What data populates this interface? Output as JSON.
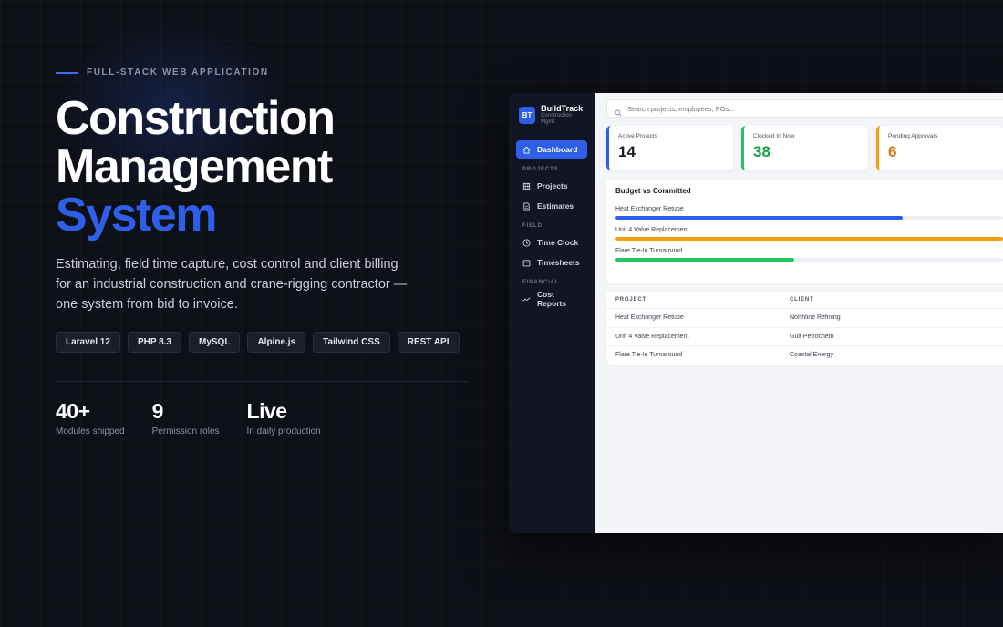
{
  "hero": {
    "eyebrow": "FULL-STACK WEB APPLICATION",
    "title_line1": "Construction",
    "title_line2": "Management",
    "title_line3": "System",
    "description": "Estimating, field time capture, cost control and client billing for an industrial construction and crane-rigging contractor — one system from bid to invoice.",
    "tags": [
      "Laravel 12",
      "PHP 8.3",
      "MySQL",
      "Alpine.js",
      "Tailwind CSS",
      "REST API"
    ],
    "stats": [
      {
        "value": "40+",
        "label": "Modules shipped"
      },
      {
        "value": "9",
        "label": "Permission roles"
      },
      {
        "value": "Live",
        "label": "In daily production"
      }
    ]
  },
  "app": {
    "brand": {
      "logo": "BT",
      "name": "BuildTrack",
      "subtitle": "Construction Mgmt"
    },
    "nav": {
      "dashboard": "Dashboard",
      "section_projects": "PROJECTS",
      "projects": "Projects",
      "estimates": "Estimates",
      "section_field": "FIELD",
      "time_clock": "Time Clock",
      "timesheets": "Timesheets",
      "section_financial": "FINANCIAL",
      "cost_reports": "Cost Reports"
    },
    "search": {
      "placeholder": "Search projects, employees, POs..."
    },
    "kpis": [
      {
        "label": "Active Projects",
        "value": "14",
        "color": "#2f5fe8",
        "value_color": "#161a24"
      },
      {
        "label": "Clocked In Now",
        "value": "38",
        "color": "#22c55e",
        "value_color": "#16a34a"
      },
      {
        "label": "Pending Approvals",
        "value": "6",
        "color": "#f59e0b",
        "value_color": "#d97706"
      }
    ],
    "budget": {
      "title": "Budget vs Committed",
      "rows": [
        {
          "label": "Heat Exchanger Retube",
          "fraction": 0.74,
          "color": "#2f5fe8"
        },
        {
          "label": "Unit 4 Valve Replacement",
          "fraction": 1.0,
          "color": "#f59e0b"
        },
        {
          "label": "Flare Tie-In Turnaround",
          "fraction": 0.46,
          "color": "#22c55e"
        }
      ]
    },
    "table": {
      "headers": [
        "PROJECT",
        "CLIENT"
      ],
      "rows": [
        [
          "Heat Exchanger Retube",
          "Northline Refining"
        ],
        [
          "Unit 4 Valve Replacement",
          "Gulf Petrochem"
        ],
        [
          "Flare Tie-In Turnaround",
          "Coastal Energy"
        ]
      ]
    }
  }
}
